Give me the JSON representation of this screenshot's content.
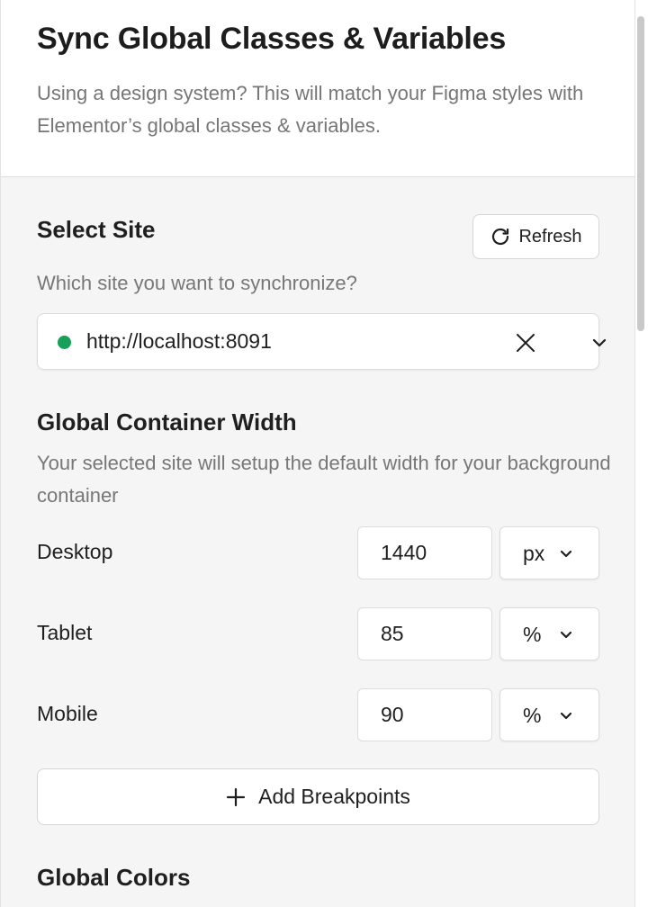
{
  "header": {
    "title": "Sync Global Classes & Variables",
    "description": "Using a design system? This will match your Figma styles with Elementor’s global classes & variables."
  },
  "select_site": {
    "title": "Select Site",
    "refresh_label": "Refresh",
    "question": "Which site you want to synchronize?",
    "selected_site": "http://localhost:8091",
    "status_color": "#16a05a"
  },
  "container_width": {
    "title": "Global Container Width",
    "description": "Your selected site will setup the default width for your background container",
    "breakpoints": [
      {
        "label": "Desktop",
        "value": "1440",
        "unit": "px"
      },
      {
        "label": "Tablet",
        "value": "85",
        "unit": "%"
      },
      {
        "label": "Mobile",
        "value": "90",
        "unit": "%"
      }
    ],
    "add_label": "Add Breakpoints"
  },
  "global_colors": {
    "title": "Global Colors"
  }
}
